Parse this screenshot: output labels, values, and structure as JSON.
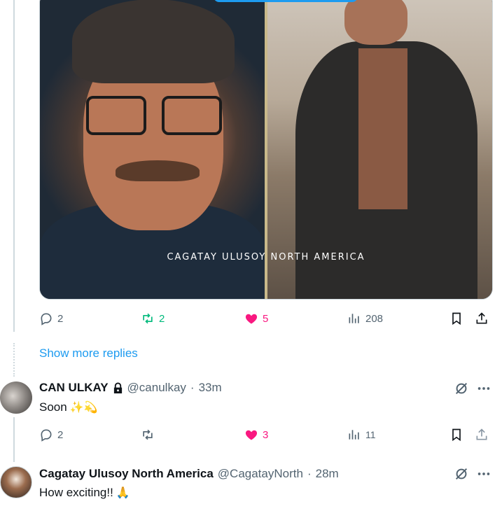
{
  "media": {
    "caption": "CAGATAY ULUSOY NORTH AMERICA"
  },
  "tweet1_actions": {
    "replies": "2",
    "retweets": "2",
    "likes": "5",
    "views": "208"
  },
  "show_more": "Show more replies",
  "reply1": {
    "name": "CAN ULKAY",
    "handle": "@canulkay",
    "separator": "·",
    "time": "33m",
    "text": "Soon",
    "emojis": "✨💫",
    "replies": "2",
    "retweets": "",
    "likes": "3",
    "views": "11"
  },
  "reply2": {
    "name": "Cagatay Ulusoy North America",
    "handle": "@CagatayNorth",
    "separator": "·",
    "time": "28m",
    "text": "How exciting!!",
    "emojis": "🙏"
  },
  "colors": {
    "accent": "#1d9bf0",
    "like": "#f91880",
    "retweet": "#00ba7c",
    "muted": "#536471",
    "border": "#cfd9de"
  },
  "icons": [
    "reply-icon",
    "retweet-icon",
    "heart-icon",
    "views-icon",
    "bookmark-icon",
    "share-icon",
    "lock-icon",
    "grok-icon",
    "more-icon"
  ]
}
